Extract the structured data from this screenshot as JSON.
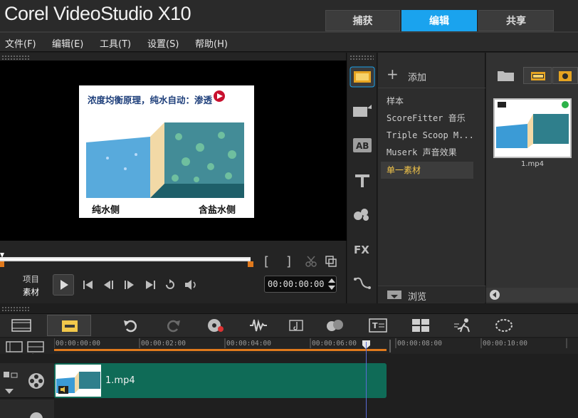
{
  "app": {
    "title": "Corel VideoStudio X10"
  },
  "tabs": [
    {
      "label": "捕获",
      "active": false
    },
    {
      "label": "编辑",
      "active": true
    },
    {
      "label": "共享",
      "active": false
    }
  ],
  "menu": [
    "文件(F)",
    "编辑(E)",
    "工具(T)",
    "设置(S)",
    "帮助(H)"
  ],
  "preview": {
    "frame_title": "浓度均衡原理，纯水自动：渗透",
    "left_label": "纯水侧",
    "right_label": "含盐水侧"
  },
  "player": {
    "mode_project": "项目",
    "mode_clip": "素材",
    "timecode": "00:00:00:00",
    "mark_in": "[",
    "mark_out": "]"
  },
  "library": {
    "add_label": "添加",
    "items": [
      {
        "label": "样本",
        "selected": false
      },
      {
        "label": "ScoreFitter 音乐",
        "selected": false
      },
      {
        "label": "Triple Scoop M...",
        "selected": false
      },
      {
        "label": "Muserk 声音效果",
        "selected": false
      },
      {
        "label": "单一素材",
        "selected": true
      }
    ],
    "browse_label": "浏览",
    "thumb_name": "1.mp4"
  },
  "timeline": {
    "ruler": [
      "00:00:00:00",
      "00:00:02:00",
      "00:00:04:00",
      "00:00:06:00",
      "00:00:08:00",
      "00:00:10:00"
    ],
    "clip_name": "1.mp4",
    "zoom_label": "+/−"
  },
  "colors": {
    "accent": "#1aa3ee",
    "clip": "#0f6b57",
    "selected_item": "#f4c64a",
    "progress": "#e0791c"
  }
}
